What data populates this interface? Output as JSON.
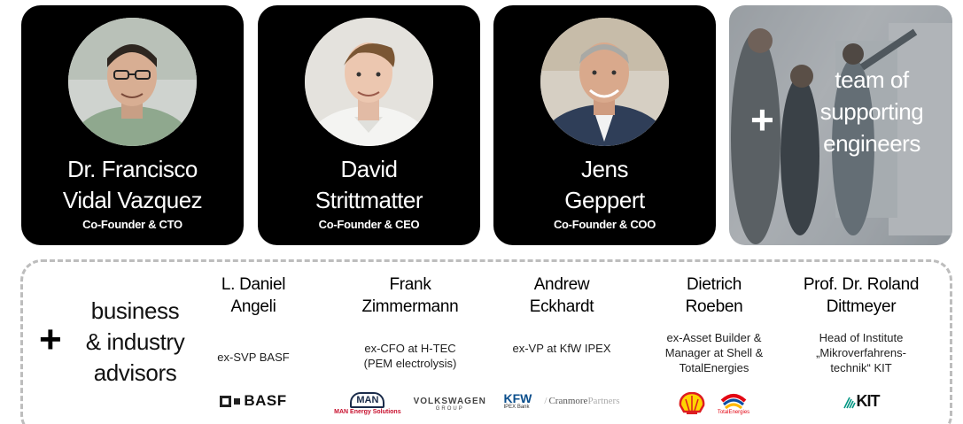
{
  "founders": [
    {
      "name_line1": "Dr. Francisco",
      "name_line2": "Vidal Vazquez",
      "role": "Co-Founder & CTO"
    },
    {
      "name_line1": "David",
      "name_line2": "Strittmatter",
      "role": "Co-Founder & CEO"
    },
    {
      "name_line1": "Jens",
      "name_line2": "Geppert",
      "role": "Co-Founder & COO"
    }
  ],
  "team": {
    "plus": "+",
    "line1": "team of",
    "line2": "supporting",
    "line3": "engineers"
  },
  "advisors_section": {
    "plus": "+",
    "title_line1": "business",
    "title_line2": "& industry",
    "title_line3": "advisors"
  },
  "advisors": [
    {
      "name_line1": "L. Daniel",
      "name_line2": "Angeli",
      "role_line1": "ex-SVP BASF",
      "role_line2": "",
      "role_line3": ""
    },
    {
      "name_line1": "Frank",
      "name_line2": "Zimmermann",
      "role_line1": "ex-CFO at H-TEC",
      "role_line2": "(PEM electrolysis)",
      "role_line3": ""
    },
    {
      "name_line1": "Andrew",
      "name_line2": "Eckhardt",
      "role_line1": "ex-VP at KfW IPEX",
      "role_line2": "",
      "role_line3": ""
    },
    {
      "name_line1": "Dietrich",
      "name_line2": "Roeben",
      "role_line1": "ex-Asset Builder &",
      "role_line2": "Manager at Shell &",
      "role_line3": "TotalEnergies"
    },
    {
      "name_line1": "Prof. Dr. Roland",
      "name_line2": "Dittmeyer",
      "role_line1": "Head of Institute",
      "role_line2": "„Mikroverfahrens-",
      "role_line3": "technik“ KIT"
    }
  ],
  "logos": {
    "basf": "BASF",
    "man": "MAN",
    "man_sub": "MAN Energy Solutions",
    "vw": "VOLKSWAGEN",
    "vw_sub": "GROUP",
    "kfw": "KFW",
    "kfw_sub": "IPEX Bank",
    "cranmore": "Cranmore",
    "cranmore_light": "Partners",
    "total": "TotalEnergies",
    "kit": "KIT"
  },
  "colors": {
    "card_bg": "#000000",
    "card_text": "#ffffff",
    "dashed_border": "#bdbdbd"
  }
}
